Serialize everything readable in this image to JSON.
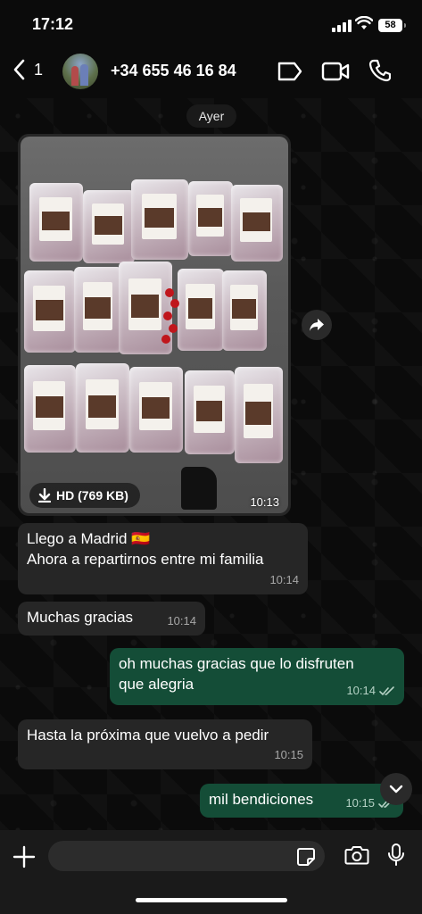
{
  "status_bar": {
    "time": "17:12",
    "battery": "58"
  },
  "header": {
    "back_count": "1",
    "contact_name": "+34 655 46 16 84"
  },
  "date_divider": "Ayer",
  "media_message": {
    "hd_label": "HD (769 KB)",
    "time": "10:13"
  },
  "messages": [
    {
      "direction": "in",
      "line1": "Llego a Madrid 🇪🇸",
      "line2": "Ahora a repartirnos entre mi familia",
      "time": "10:14"
    },
    {
      "direction": "in",
      "line1": "Muchas gracias",
      "time": "10:14"
    },
    {
      "direction": "out",
      "line1": "oh muchas gracias que lo disfruten",
      "line2": "que alegria",
      "time": "10:14"
    },
    {
      "direction": "in",
      "line1": "Hasta la próxima que vuelvo a pedir",
      "time": "10:15"
    },
    {
      "direction": "out",
      "line1": "mil bendiciones",
      "time": "10:15"
    }
  ],
  "input": {
    "placeholder": ""
  },
  "colors": {
    "incoming": "#262626",
    "outgoing": "#144d37",
    "background": "#0b0b0b"
  },
  "icons": [
    "back-chevron-icon",
    "sticker-icon",
    "video-call-icon",
    "phone-icon",
    "download-icon",
    "forward-icon",
    "double-check-icon",
    "chevron-down-icon",
    "plus-icon",
    "sticker-icon",
    "camera-icon",
    "microphone-icon"
  ]
}
